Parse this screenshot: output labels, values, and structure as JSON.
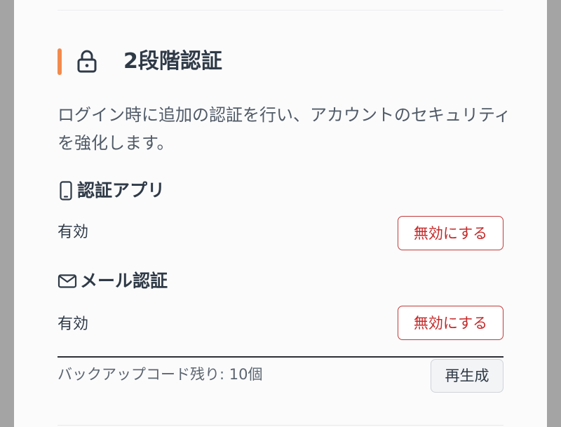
{
  "section": {
    "title": "2段階認証",
    "description": "ログイン時に追加の認証を行い、アカウントのセキュリティを強化します。"
  },
  "methods": [
    {
      "icon": "smartphone-icon",
      "title": "認証アプリ",
      "status": "有効",
      "disable_label": "無効にする"
    },
    {
      "icon": "mail-icon",
      "title": "メール認証",
      "status": "有効",
      "disable_label": "無効にする"
    }
  ],
  "backup": {
    "remaining_text": "バックアップコード残り: 10個",
    "regenerate_label": "再生成"
  },
  "colors": {
    "accent": "#f28a4d",
    "danger": "#c62828",
    "text": "#2f3a47"
  }
}
